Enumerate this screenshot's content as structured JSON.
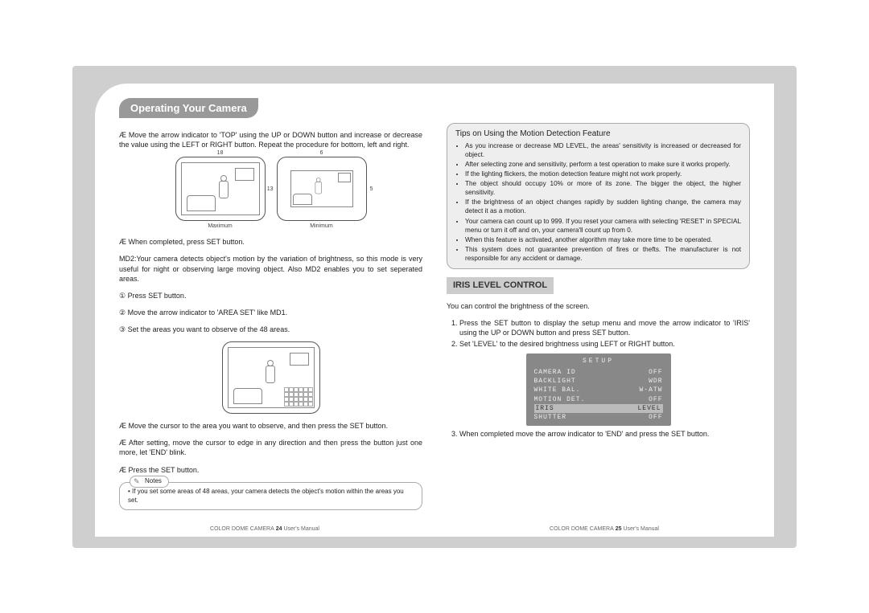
{
  "title_tab": "Operating Your Camera",
  "left": {
    "p1": "Æ Move the arrow indicator to 'TOP' using the UP or DOWN button and increase or decrease the value using the LEFT or RIGHT button. Repeat the procedure for bottom, left and right.",
    "fig_max_label": "Maximum",
    "fig_min_label": "Minimum",
    "fig_max_top": "18",
    "fig_max_right": "13",
    "fig_min_top": "6",
    "fig_min_right": "5",
    "p2": "Æ When completed, press SET button.",
    "p3": "MD2:Your camera detects object's motion by the variation of brightness, so this mode is very useful for night or observing large moving object. Also MD2 enables you to set seperated areas.",
    "b1": "① Press SET button.",
    "b2": "② Move the arrow indicator to 'AREA SET' like MD1.",
    "b3": "③ Set the areas you want to observe of the 48 areas.",
    "p4": "Æ Move the cursor to the area you want to observe, and then press the SET button.",
    "p5": "Æ After setting, move the cursor to edge in any direction and then press the button just one more, let 'END' blink.",
    "p6": "Æ Press the SET button.",
    "notes_label": "Notes",
    "notes_text": "If you set some areas of 48 areas, your camera detects the object's motion within the areas you set."
  },
  "right": {
    "tips_title": "Tips on Using the Motion Detection Feature",
    "tips": [
      "As you increase or decrease MD LEVEL, the areas' sensitivity is increased or decreased for object.",
      "After selecting zone and sensitivity, perform a test operation to make sure it works properly.",
      "If the lighting flickers, the motion detection feature might not work properly.",
      "The object should occupy 10% or more of its zone. The bigger the object, the higher sensitivity.",
      "If the brightness of an object changes rapidly by sudden lighting change, the camera may detect it as a motion.",
      "Your camera can count up to 999. If you reset your camera with selecting 'RESET' in SPECIAL menu or turn it off and on, your camera'll count up from 0.",
      "When this feature is activated, another algorithm may take more time to be operated.",
      "This system does not guarantee prevention of fires or thefts. The manufacturer is not responsible for any accident or damage."
    ],
    "iris_heading": "IRIS LEVEL CONTROL",
    "iris_intro": "You can control the brightness of the screen.",
    "iris_steps": [
      "Press the SET button to display the setup menu and move the arrow indicator to 'IRIS' using the UP or DOWN button and press SET button.",
      "Set 'LEVEL' to the desired brightness using LEFT or RIGHT button."
    ],
    "setup": {
      "title": "SETUP",
      "rows": [
        {
          "k": "CAMERA ID",
          "v": "OFF"
        },
        {
          "k": "BACKLIGHT",
          "v": "WDR"
        },
        {
          "k": "WHITE BAL.",
          "v": "W-ATW"
        },
        {
          "k": "MOTION DET.",
          "v": "OFF"
        },
        {
          "k": "IRIS",
          "v": "LEVEL",
          "hi": true
        },
        {
          "k": "SHUTTER",
          "v": "OFF"
        }
      ]
    },
    "iris_step3": "When completed move the arrow indicator to 'END' and press the SET button."
  },
  "footer": {
    "product": "COLOR DOME CAMERA",
    "left_page": "24",
    "right_page": "25",
    "suffix": "User's Manual"
  }
}
